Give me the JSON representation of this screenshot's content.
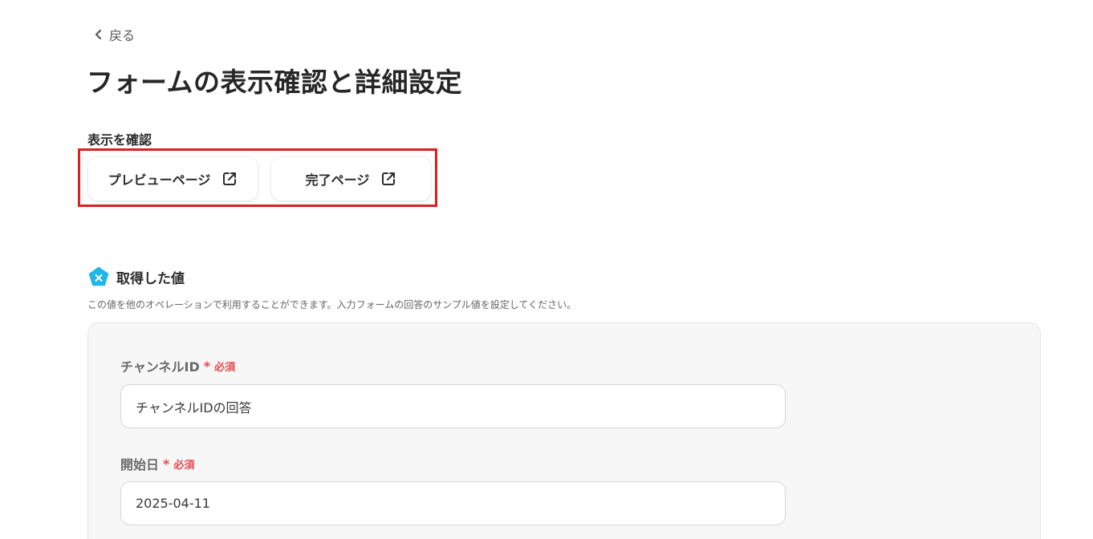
{
  "nav": {
    "back_label": "戻る"
  },
  "page": {
    "title": "フォームの表示確認と詳細設定"
  },
  "display_check": {
    "label": "表示を確認",
    "buttons": [
      {
        "label": "プレビューページ",
        "icon": "external-link-icon"
      },
      {
        "label": "完了ページ",
        "icon": "external-link-icon"
      }
    ]
  },
  "acquired_values": {
    "icon": "x-pentagon-icon",
    "title": "取得した値",
    "description": "この値を他のオペレーションで利用することができます。入力フォームの回答のサンプル値を設定してください。",
    "fields": [
      {
        "label": "チャンネルID",
        "required_mark": "*",
        "required_text": "必須",
        "value": "チャンネルIDの回答"
      },
      {
        "label": "開始日",
        "required_mark": "*",
        "required_text": "必須",
        "value": "2025-04-11"
      }
    ]
  },
  "colors": {
    "highlight_border": "#dd1f1f",
    "required": "#e5484d",
    "badge_icon": "#1fb6e8"
  }
}
